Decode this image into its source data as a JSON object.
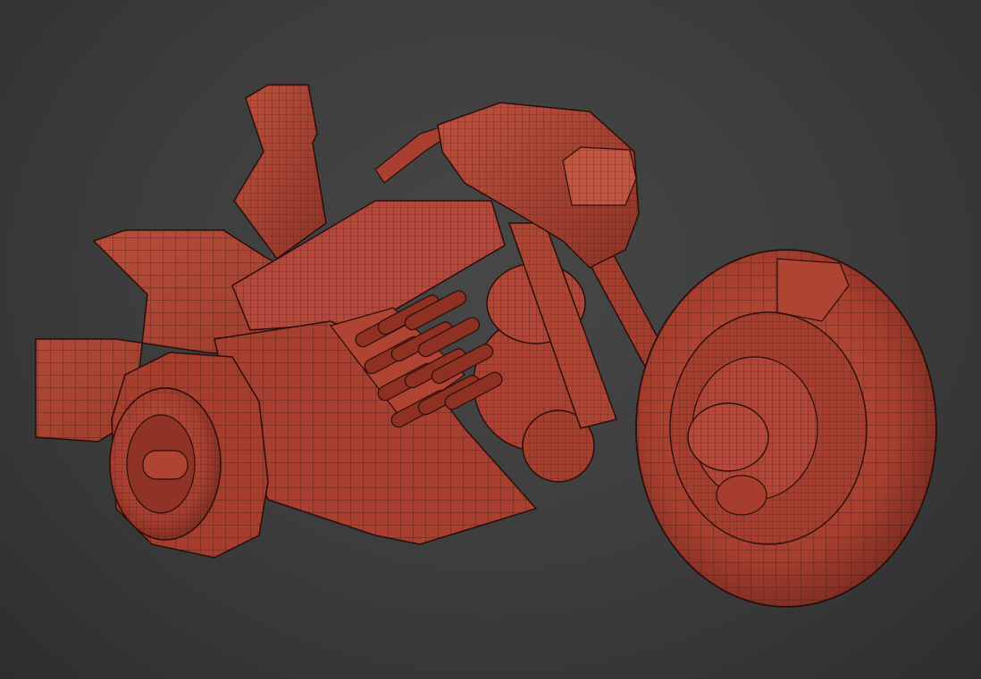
{
  "scene": {
    "subject": "motorcycle-wireframe-model",
    "colors": {
      "background": "#3e3e3e",
      "model_fill": "#b04433",
      "model_shadow": "#7a2a20",
      "model_highlight": "#c85a46",
      "wireframe": "#2a0e0a"
    }
  }
}
